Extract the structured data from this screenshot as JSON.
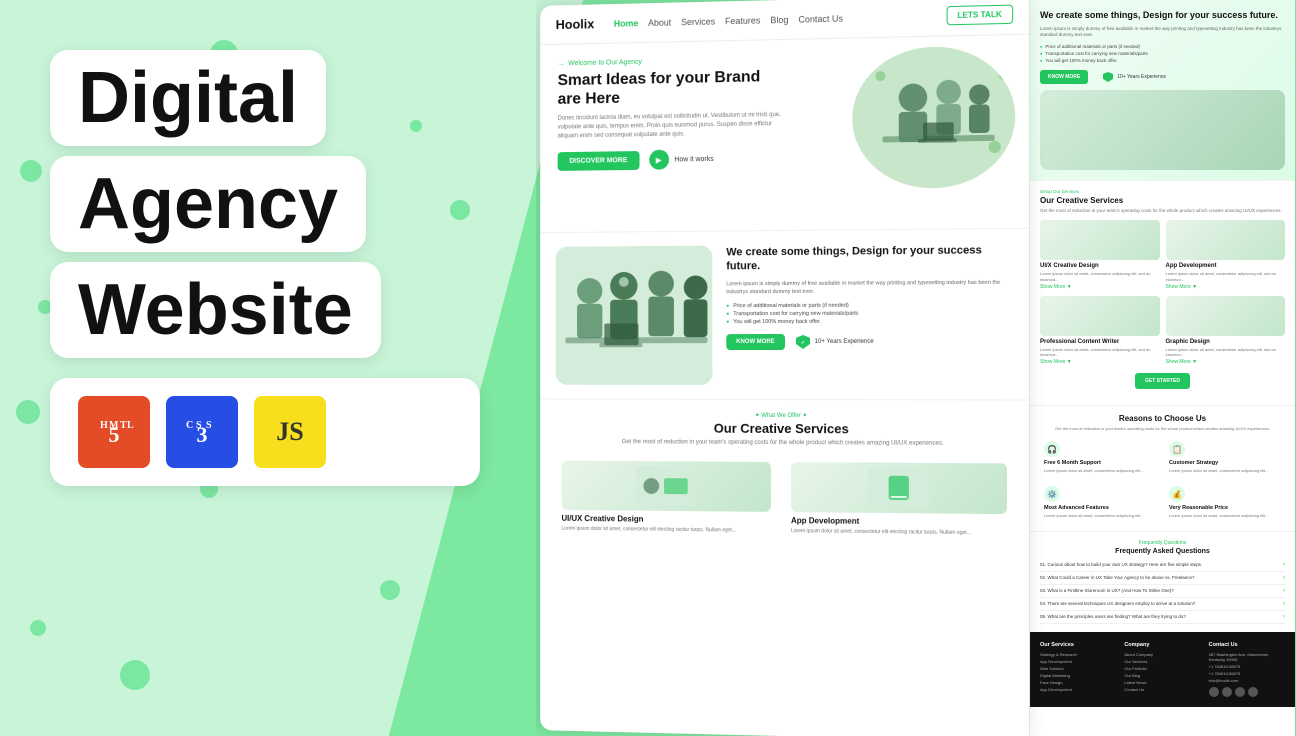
{
  "background": {
    "color": "#7de8a0"
  },
  "left_panel": {
    "line1": "Digital",
    "line2": "Agency",
    "line3": "Website",
    "icons": [
      {
        "name": "HTML5",
        "abbr": "5",
        "bg": "#e34c26"
      },
      {
        "name": "CSS3",
        "abbr": "3",
        "bg": "#264de4"
      },
      {
        "name": "JavaScript",
        "abbr": "JS",
        "bg": "#f7df1e",
        "color": "#333"
      }
    ]
  },
  "navbar": {
    "logo": "Hoolix",
    "links": [
      "Home",
      "About",
      "Services",
      "Features",
      "Blog",
      "Contact Us"
    ],
    "cta": "LETS TALK"
  },
  "hero": {
    "label": "Welcome to Our Agency",
    "title": "Smart Ideas for your Brand are Here",
    "text": "Donec tincidunt lacinia diam, eu volutpat est sollicitudin ut. Vestibulum ut mi tristí que, vulputate ante quis, tempus enim. Proin quis euismod purus. Suspen disse effictur aliquam enim sed consequat vulputate ante quis.",
    "cta_primary": "DISCOVER MORE",
    "cta_secondary": "How it works"
  },
  "section2": {
    "title": "We create some things, Design for your success future.",
    "body": "Lorem ipsum is simply dummy of free available in market the way printing and typesetting industry has been the industrys standard dummy text ever.",
    "bullets": [
      "Price of additional materials or parts (if needed)",
      "Transportation cost for carrying new materials/parts",
      "You will get 100% money back offer."
    ],
    "cta": "KNOW MORE",
    "badge": "10+ Years Experience"
  },
  "services": {
    "label": "What We Offer",
    "title": "Our Creative Services",
    "subtitle": "Get the most of reduction in your team's operating costs for the whole product which creates amazing UI/UX experiences.",
    "items": [
      {
        "title": "UI/UX Creative Design",
        "text": "Lorem ipsum dolor sit amet, consectetur elit electing racitur turpis. Nullam eget..."
      },
      {
        "title": "App Development",
        "text": "Lorem ipsum dolor sit amet, consectetur elit electing racitur turpis. Nullam eget..."
      }
    ]
  },
  "side_hero": {
    "title": "We create some things, Design for your success future.",
    "text": "Lorem ipsum is simply dummy of free available in market the way printing and typesetting industry has been the industrys standard dummy text ever.",
    "bullets": [
      "Price of additional materials or parts (if needed)",
      "Transportation cost for carrying new materials/parts",
      "You will get 100% money back offer."
    ],
    "cta": "KNOW MORE",
    "badge": "10+ Years Experience"
  },
  "side_services": {
    "label": "Setup Our Services",
    "title": "Our Creative Services",
    "text": "Get the most of reduction in your team's operating costs for the whole product which creates amazing UI/UX experiences.",
    "items": [
      {
        "title": "UI/X Creative Design",
        "text": "Lorem ipsum dolor sit amet, consectetur adipiscing elit, sed do eiusmod..."
      },
      {
        "title": "App Development",
        "text": "Lorem ipsum dolor sit amet, consectetur adipiscing elit, sed do eiusmod..."
      },
      {
        "title": "Professional Content Writer",
        "text": "Lorem ipsum dolor sit amet, consectetur adipiscing elit, sed do eiusmod..."
      },
      {
        "title": "Graphic Design",
        "text": "Lorem ipsum dolor sit amet, consectetur adipiscing elit, sed do eiusmod..."
      }
    ],
    "cta": "GET STARTED"
  },
  "reasons": {
    "title": "Reasons to Choose Us",
    "text": "Get the most of reduction in your team's operating costs for the whole product which creates amazing UI/UX experiences.",
    "items": [
      {
        "icon": "🎧",
        "title": "Free 6 Month Support",
        "text": "Lorem ipsum dolor sit amet, consectetur adipiscing elit..."
      },
      {
        "icon": "📋",
        "title": "Customer Strategy",
        "text": "Lorem ipsum dolor sit amet, consectetur adipiscing elit..."
      },
      {
        "icon": "⚙️",
        "title": "Most Advanced Features",
        "text": "Lorem ipsum dolor sit amet, consectetur adipiscing elit..."
      },
      {
        "icon": "💰",
        "title": "Very Reasonable Price",
        "text": "Lorem ipsum dolor sit amet, consectetur adipiscing elit..."
      }
    ]
  },
  "faq": {
    "label": "Frequently Questions",
    "title": "Frequently Asked Questions",
    "items": [
      "01. Curious about how to build your own UX strategy? Here are five simple steps. →",
      "02. What Could a Career in UX Take Your Agency to be above vs. Freelance? →",
      "03. What is a Firstline Storeroom in UX? (And How To Strike One)? →",
      "04. There are several techniques UX designers employ to arrive at a solution? →",
      "05. What are the principles users are finding? What are they trying to do? →"
    ]
  },
  "footer": {
    "cols": [
      {
        "title": "Our Services",
        "links": [
          "Strategy & Research",
          "App Development",
          "Web Solution",
          "Digital Marketing",
          "Face Design",
          "App Development"
        ]
      },
      {
        "title": "Company",
        "links": [
          "About Company",
          "Our Services",
          "Our Portfolio",
          "Our Blog",
          "Latest News",
          "Contact Us"
        ]
      },
      {
        "title": "Contact Us",
        "links": [
          "487 Washington Ave, Manchester, Kentucky 39495",
          "+1 784619-56675",
          "+1 784619-56675",
          "info@hoolix.com"
        ]
      }
    ]
  }
}
